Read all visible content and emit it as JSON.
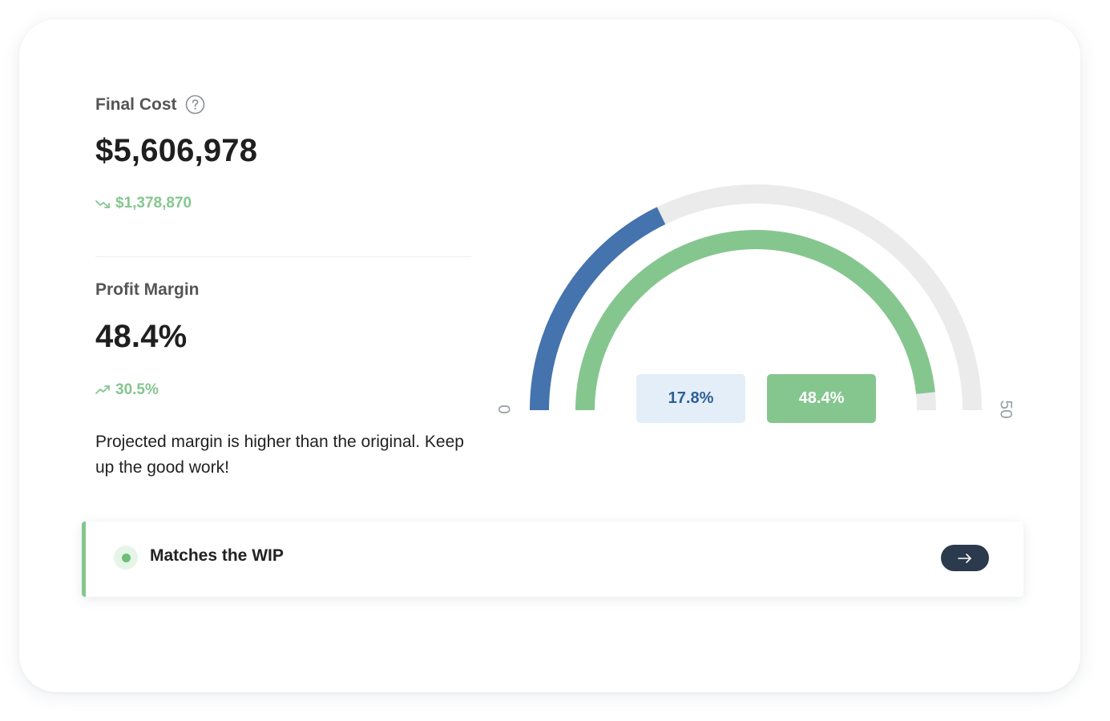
{
  "final_cost": {
    "label": "Final Cost",
    "help_icon": "question-circle-icon",
    "value": "$5,606,978",
    "delta": "$1,378,870",
    "delta_direction": "down",
    "delta_icon": "trending-down-icon"
  },
  "profit_margin": {
    "label": "Profit Margin",
    "value": "48.4%",
    "delta": "30.5%",
    "delta_direction": "up",
    "delta_icon": "trending-up-icon",
    "message": "Projected margin is higher than the original. Keep up the good work!"
  },
  "gauge": {
    "min_label": "0",
    "max_label": "50",
    "min": 0,
    "max": 50,
    "original_value": 17.8,
    "projected_value": 48.4,
    "original_label": "17.8%",
    "projected_label": "48.4%",
    "colors": {
      "track": "#ebebeb",
      "original": "#4473ad",
      "projected": "#85c68f"
    }
  },
  "status": {
    "text": "Matches the WIP",
    "accent_color": "#85c68f",
    "action_icon": "arrow-right-icon"
  }
}
